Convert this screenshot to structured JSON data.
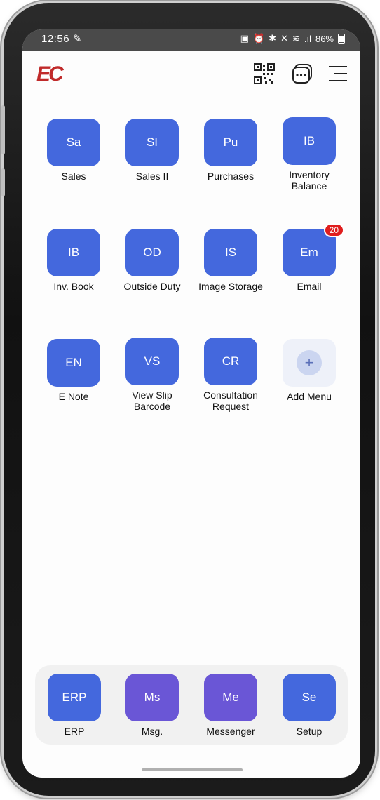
{
  "status_bar": {
    "time": "12:56",
    "battery": "86%",
    "icons": [
      "notification-icon",
      "alarm-icon",
      "bluetooth-icon",
      "mute-icon",
      "wifi-icon",
      "signal-icon",
      "battery-icon"
    ]
  },
  "header": {
    "logo_text": "EC",
    "brand_color": "#c02a2a",
    "icons": [
      "qr-code-icon",
      "chat-icon",
      "menu-icon"
    ]
  },
  "accent_color": "#4468dd",
  "messaging_color": "#6a56d6",
  "apps": [
    {
      "abbr": "Sa",
      "label": "Sales"
    },
    {
      "abbr": "SI",
      "label": "Sales II"
    },
    {
      "abbr": "Pu",
      "label": "Purchases"
    },
    {
      "abbr": "IB",
      "label": "Inventory\nBalance"
    },
    {
      "abbr": "IB",
      "label": "Inv. Book"
    },
    {
      "abbr": "OD",
      "label": "Outside Duty"
    },
    {
      "abbr": "IS",
      "label": "Image Storage"
    },
    {
      "abbr": "Em",
      "label": "Email",
      "badge": "20"
    },
    {
      "abbr": "EN",
      "label": "E Note"
    },
    {
      "abbr": "VS",
      "label": "View Slip\nBarcode"
    },
    {
      "abbr": "CR",
      "label": "Consultation\nRequest"
    },
    {
      "abbr": "+",
      "label": "Add Menu"
    }
  ],
  "dock": [
    {
      "abbr": "ERP",
      "label": "ERP"
    },
    {
      "abbr": "Ms",
      "label": "Msg."
    },
    {
      "abbr": "Me",
      "label": "Messenger"
    },
    {
      "abbr": "Se",
      "label": "Setup"
    }
  ]
}
